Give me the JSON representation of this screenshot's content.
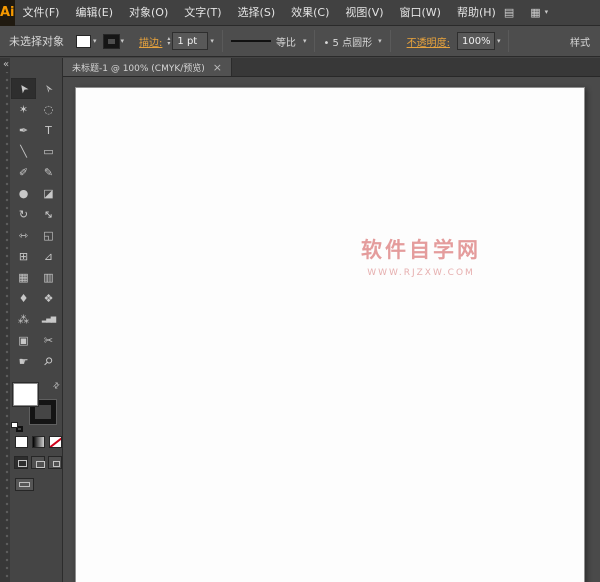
{
  "app": {
    "logo_text": "Ai"
  },
  "colors": {
    "link_orange": "#e8a33d",
    "watermark_pink": "#e49c9c",
    "ui_dark": "#434343",
    "artboard_white": "#fdfdfd"
  },
  "glyphs": {
    "caret": "▾",
    "up_small": "▴",
    "down_small": "▾",
    "close": "×",
    "collapse": "«",
    "swap": "⇄",
    "grid_icon": "▤",
    "workspace_icon": "▦"
  },
  "menubar": {
    "items": [
      "文件(F)",
      "编辑(E)",
      "对象(O)",
      "文字(T)",
      "选择(S)",
      "效果(C)",
      "视图(V)",
      "窗口(W)",
      "帮助(H)"
    ]
  },
  "controlbar": {
    "no_selection": "未选择对象",
    "stroke_label": "描边:",
    "stroke_weight": "1 pt",
    "profile_label": "等比",
    "brush_label": "• 5 点圆形",
    "opacity_label": "不透明度:",
    "opacity_value": "100%",
    "style_label": "样式"
  },
  "tabbar": {
    "title": "未标题-1 @ 100% (CMYK/预览)"
  },
  "toolbar": {
    "tools": [
      {
        "name": "selection",
        "glyph": "➤"
      },
      {
        "name": "direct-selection",
        "glyph": "➢"
      },
      {
        "name": "magic-wand",
        "glyph": "✶"
      },
      {
        "name": "lasso",
        "glyph": "◌"
      },
      {
        "name": "pen",
        "glyph": "✒"
      },
      {
        "name": "type",
        "glyph": "T"
      },
      {
        "name": "line-segment",
        "glyph": "╲"
      },
      {
        "name": "rectangle",
        "glyph": "▭"
      },
      {
        "name": "paintbrush",
        "glyph": "✐"
      },
      {
        "name": "pencil",
        "glyph": "✎"
      },
      {
        "name": "blob-brush",
        "glyph": "●"
      },
      {
        "name": "eraser",
        "glyph": "◪"
      },
      {
        "name": "rotate",
        "glyph": "↻"
      },
      {
        "name": "scale",
        "glyph": "↔"
      },
      {
        "name": "width",
        "glyph": "⇿"
      },
      {
        "name": "free-transform",
        "glyph": "◱"
      },
      {
        "name": "shape-builder",
        "glyph": "⊞"
      },
      {
        "name": "perspective-grid",
        "glyph": "⊿"
      },
      {
        "name": "mesh",
        "glyph": "▦"
      },
      {
        "name": "gradient",
        "glyph": "▥"
      },
      {
        "name": "eyedropper",
        "glyph": "♦"
      },
      {
        "name": "blend",
        "glyph": "❖"
      },
      {
        "name": "symbol-sprayer",
        "glyph": "⁂"
      },
      {
        "name": "column-graph",
        "glyph": "▂▄▆"
      },
      {
        "name": "artboard",
        "glyph": "▣"
      },
      {
        "name": "slice",
        "glyph": "✂"
      },
      {
        "name": "hand",
        "glyph": "☛"
      },
      {
        "name": "zoom",
        "glyph": "⚲"
      }
    ]
  },
  "canvas": {
    "watermark_title": "软件自学网",
    "watermark_url": "WWW.RJZXW.COM"
  }
}
